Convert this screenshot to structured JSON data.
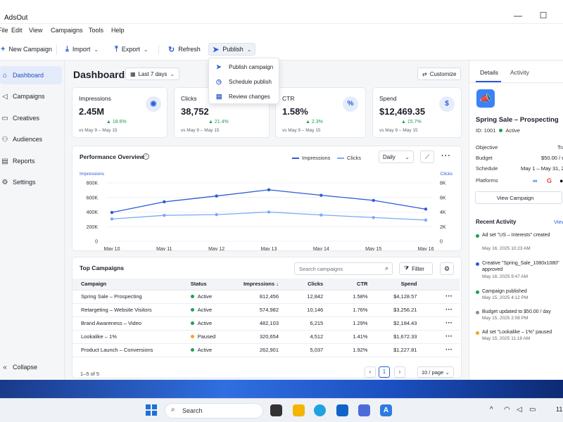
{
  "window": {
    "title": "AdsOut",
    "minimize_icon": "minimize-icon",
    "maximize_icon": "maximize-icon"
  },
  "menu": [
    "File",
    "Edit",
    "View",
    "Campaigns",
    "Tools",
    "Help"
  ],
  "toolbar": {
    "new_campaign": "New Campaign",
    "import": "Import",
    "export": "Export",
    "refresh": "Refresh",
    "publish": "Publish"
  },
  "publish_menu": {
    "items": [
      "Publish campaign",
      "Schedule publish",
      "Review changes"
    ]
  },
  "sidebar": {
    "items": [
      "Dashboard",
      "Campaigns",
      "Creatives",
      "Audiences",
      "Reports",
      "Settings"
    ],
    "collapse": "Collapse"
  },
  "header": {
    "title": "Dashboard",
    "date_range": "Last 7 days",
    "customize": "Customize"
  },
  "kpis": [
    {
      "label": "Impressions",
      "value": "2.45M",
      "delta": "18.6%",
      "compare": "vs May 9 – May 15",
      "icon": "eye-icon"
    },
    {
      "label": "Clicks",
      "value": "38,752",
      "delta": "21.4%",
      "compare": "vs May 9 – May 15",
      "icon": "cursor-icon"
    },
    {
      "label": "CTR",
      "value": "1.58%",
      "delta": "2.3%",
      "compare": "vs May 9 – May 15",
      "icon": "percent-icon"
    },
    {
      "label": "Spend",
      "value": "$12,469.35",
      "delta": "15.7%",
      "compare": "vs May 9 – May 15",
      "icon": "dollar-icon"
    }
  ],
  "performance": {
    "title": "Performance Overview",
    "legend_impressions": "Impressions",
    "legend_clicks": "Clicks",
    "granularity": "Daily",
    "left_axis_label": "Impressions",
    "right_axis_label": "Clicks"
  },
  "chart_data": {
    "type": "line",
    "categories": [
      "May 10",
      "May 11",
      "May 12",
      "May 13",
      "May 14",
      "May 15",
      "May 16"
    ],
    "series": [
      {
        "name": "Impressions",
        "axis": "left",
        "color": "#2c5bd6",
        "values": [
          395000,
          540000,
          620000,
          705000,
          630000,
          560000,
          440000
        ]
      },
      {
        "name": "Clicks",
        "axis": "right",
        "color": "#7aa9f3",
        "values": [
          3050,
          3550,
          3650,
          4000,
          3600,
          3250,
          2900
        ]
      }
    ],
    "left_ylim": [
      0,
      800000
    ],
    "left_ticks": [
      "0",
      "200K",
      "400K",
      "600K",
      "800K"
    ],
    "right_ylim": [
      0,
      8000
    ],
    "right_ticks": [
      "0",
      "2K",
      "4K",
      "6K",
      "8K"
    ],
    "ylabel_left": "Impressions",
    "ylabel_right": "Clicks",
    "grid": true,
    "legend": "top-right"
  },
  "top_campaigns": {
    "title": "Top Campaigns",
    "search_placeholder": "Search campaigns",
    "filter": "Filter",
    "columns": [
      "Campaign",
      "Status",
      "Impressions ↓",
      "Clicks",
      "CTR",
      "Spend"
    ],
    "rows": [
      {
        "campaign": "Spring Sale – Prospecting",
        "status": "Active",
        "impressions": "812,456",
        "clicks": "12,842",
        "ctr": "1.58%",
        "spend": "$4,128.57"
      },
      {
        "campaign": "Retargeting – Website Visitors",
        "status": "Active",
        "impressions": "574,982",
        "clicks": "10,146",
        "ctr": "1.76%",
        "spend": "$3,256.21"
      },
      {
        "campaign": "Brand Awareness – Video",
        "status": "Active",
        "impressions": "482,103",
        "clicks": "6,215",
        "ctr": "1.29%",
        "spend": "$2,184.43"
      },
      {
        "campaign": "Lookalike – 1%",
        "status": "Paused",
        "impressions": "320,654",
        "clicks": "4,512",
        "ctr": "1.41%",
        "spend": "$1,672.33"
      },
      {
        "campaign": "Product Launch – Conversions",
        "status": "Active",
        "impressions": "262,901",
        "clicks": "5,037",
        "ctr": "1.92%",
        "spend": "$1,227.81"
      }
    ],
    "pager_info": "1–5 of 5",
    "current_page": "1",
    "per_page": "10 / page"
  },
  "status_colors": {
    "Active": "#1f9d55",
    "Paused": "#f2a61c"
  },
  "details": {
    "tab_details": "Details",
    "tab_activity": "Activity",
    "campaign_name": "Spring Sale – Prospecting",
    "id_label": "ID: 1001",
    "status": "Active",
    "objective_label": "Objective",
    "objective_value": "Tra",
    "budget_label": "Budget",
    "budget_value": "$50.00 / d",
    "schedule_label": "Schedule",
    "schedule_value": "May 1 – May 31, 20",
    "platforms_label": "Platforms",
    "view_campaign": "View Campaign",
    "recent_activity": "Recent Activity",
    "view_all": "View",
    "activity": [
      {
        "text": "Ad set \"US – Interests\" created",
        "time": "May 16, 2025 10:23 AM",
        "color": "#1f9d55"
      },
      {
        "text": "Creative \"Spring_Sale_1080x1080\" approved",
        "time": "May 16, 2025 9:47 AM",
        "color": "#2c5bd6"
      },
      {
        "text": "Campaign published",
        "time": "May 15, 2025 4:12 PM",
        "color": "#1f9d55"
      },
      {
        "text": "Budget updated to $50.00 / day",
        "time": "May 15, 2025 2:08 PM",
        "color": "#8a8f99"
      },
      {
        "text": "Ad set \"Lookalike – 1%\" paused",
        "time": "May 15, 2025 11:18 AM",
        "color": "#f2a61c"
      }
    ]
  },
  "taskbar": {
    "search": "Search",
    "clock": "11"
  }
}
